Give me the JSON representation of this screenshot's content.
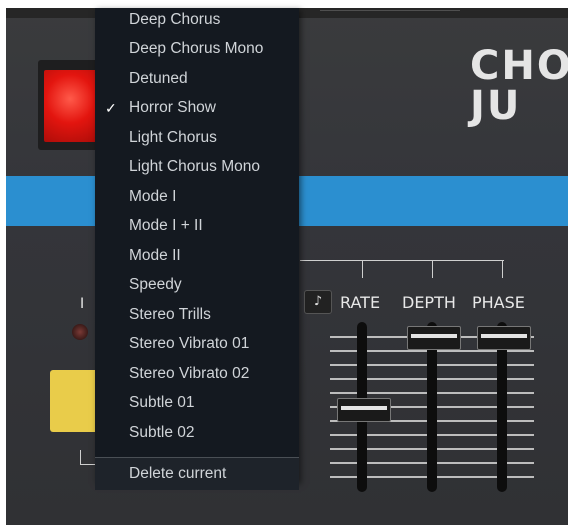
{
  "logo_top": "CHO",
  "logo_bottom": "JU",
  "sync_icon": "music-note-icon",
  "controls": {
    "rate_label": "RATE",
    "depth_label": "DEPTH",
    "phase_label": "PHASE",
    "mode_label": "I",
    "sync_glyph": "♪"
  },
  "menu": {
    "checkmark": "✓",
    "items": [
      {
        "label": "Deep Chorus"
      },
      {
        "label": "Deep Chorus Mono"
      },
      {
        "label": "Detuned"
      },
      {
        "label": "Horror Show",
        "checked": true
      },
      {
        "label": "Light Chorus"
      },
      {
        "label": "Light Chorus Mono"
      },
      {
        "label": "Mode I"
      },
      {
        "label": "Mode I + II"
      },
      {
        "label": "Mode II"
      },
      {
        "label": "Speedy"
      },
      {
        "label": "Stereo Trills"
      },
      {
        "label": "Stereo Vibrato 01"
      },
      {
        "label": "Stereo Vibrato 02"
      },
      {
        "label": "Subtle 01"
      },
      {
        "label": "Subtle 02"
      }
    ],
    "delete_label": "Delete current"
  },
  "colors": {
    "power_red": "#e3150f",
    "stripe_blue": "#2b8fd0",
    "button_yellow": "#e9cc4a",
    "menu_bg": "#141920"
  }
}
